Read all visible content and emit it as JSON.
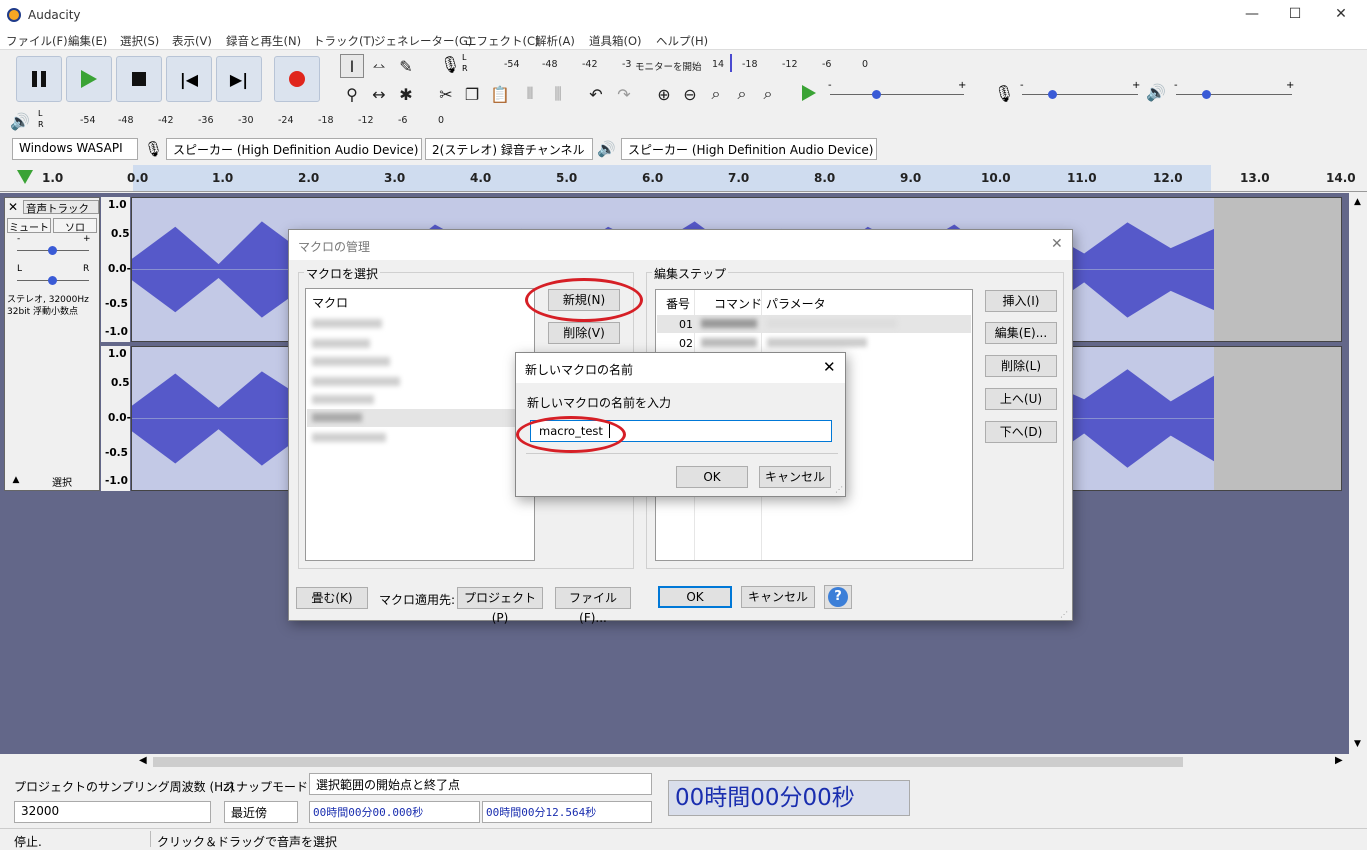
{
  "app": {
    "title": "Audacity"
  },
  "window_controls": {
    "minimize": "—",
    "maximize": "☐",
    "close": "✕"
  },
  "menu": [
    "ファイル(F)",
    "編集(E)",
    "選択(S)",
    "表示(V)",
    "録音と再生(N)",
    "トラック(T)",
    "ジェネレーター(G)",
    "エフェクト(C)",
    "解析(A)",
    "道具箱(O)",
    "ヘルプ(H)"
  ],
  "meter": {
    "rec_ticks": [
      "-54",
      "-48",
      "-42",
      "-3",
      "モニターを開始",
      "14",
      "-18",
      "-12",
      "-6",
      "0"
    ],
    "play_ticks": [
      "-54",
      "-48",
      "-42",
      "-36",
      "-30",
      "-24",
      "-18",
      "-12",
      "-6",
      "0"
    ],
    "lr": "L\nR",
    "slider_minus": "-",
    "slider_plus": "+"
  },
  "devices": {
    "host": "Windows WASAPI",
    "rec_device": "スピーカー (High Definition Audio Device) (loo",
    "channels": "2(ステレオ) 録音チャンネル",
    "play_device": "スピーカー (High Definition Audio Device)"
  },
  "ruler": {
    "ticks": [
      "1.0",
      "0.0",
      "1.0",
      "2.0",
      "3.0",
      "4.0",
      "5.0",
      "6.0",
      "7.0",
      "8.0",
      "9.0",
      "10.0",
      "11.0",
      "12.0",
      "13.0",
      "14.0"
    ]
  },
  "track": {
    "name": "音声トラック",
    "mute": "ミュート",
    "solo": "ソロ",
    "pan_l": "L",
    "pan_r": "R",
    "gain_minus": "-",
    "gain_plus": "+",
    "info": "ステレオ, 32000Hz\n32bit 浮動小数点",
    "select": "選択",
    "scale": [
      "1.0",
      "0.5",
      "0.0-",
      "-0.5",
      "-1.0"
    ]
  },
  "macro_dialog": {
    "title": "マクロの管理",
    "select_group": "マクロを選択",
    "list_header": "マクロ",
    "new_btn": "新規(N)",
    "delete_btn": "削除(V)",
    "steps_group": "編集ステップ",
    "col_num": "番号",
    "col_cmd": "コマンド",
    "col_param": "パラメータ",
    "rows": [
      "01",
      "02"
    ],
    "insert_btn": "挿入(I)",
    "edit_btn": "編集(E)...",
    "remove_btn": "削除(L)",
    "up_btn": "上へ(U)",
    "down_btn": "下へ(D)",
    "shrink_btn": "畳む(K)",
    "apply_label": "マクロ適用先:",
    "project_btn": "プロジェクト(P)",
    "file_btn": "ファイル(F)...",
    "ok": "OK",
    "cancel": "キャンセル",
    "help": "?"
  },
  "name_dialog": {
    "title": "新しいマクロの名前",
    "prompt": "新しいマクロの名前を入力",
    "value": "macro_test",
    "ok": "OK",
    "cancel": "キャンセル"
  },
  "bottom": {
    "rate_label": "プロジェクトのサンプリング周波数 (Hz)",
    "snap_label": "スナップモード",
    "sel_mode": "選択範囲の開始点と終了点",
    "rate": "32000",
    "snap": "最近傍",
    "start": "00時間00分00.000秒",
    "end": "00時間00分12.564秒",
    "big_time": "00時間00分00秒"
  },
  "status": {
    "left": "停止.",
    "right": "クリック＆ドラッグで音声を選択"
  },
  "colors": {
    "wave": "#5659c9",
    "accent": "#0078d7",
    "highlight": "#d61f26"
  }
}
